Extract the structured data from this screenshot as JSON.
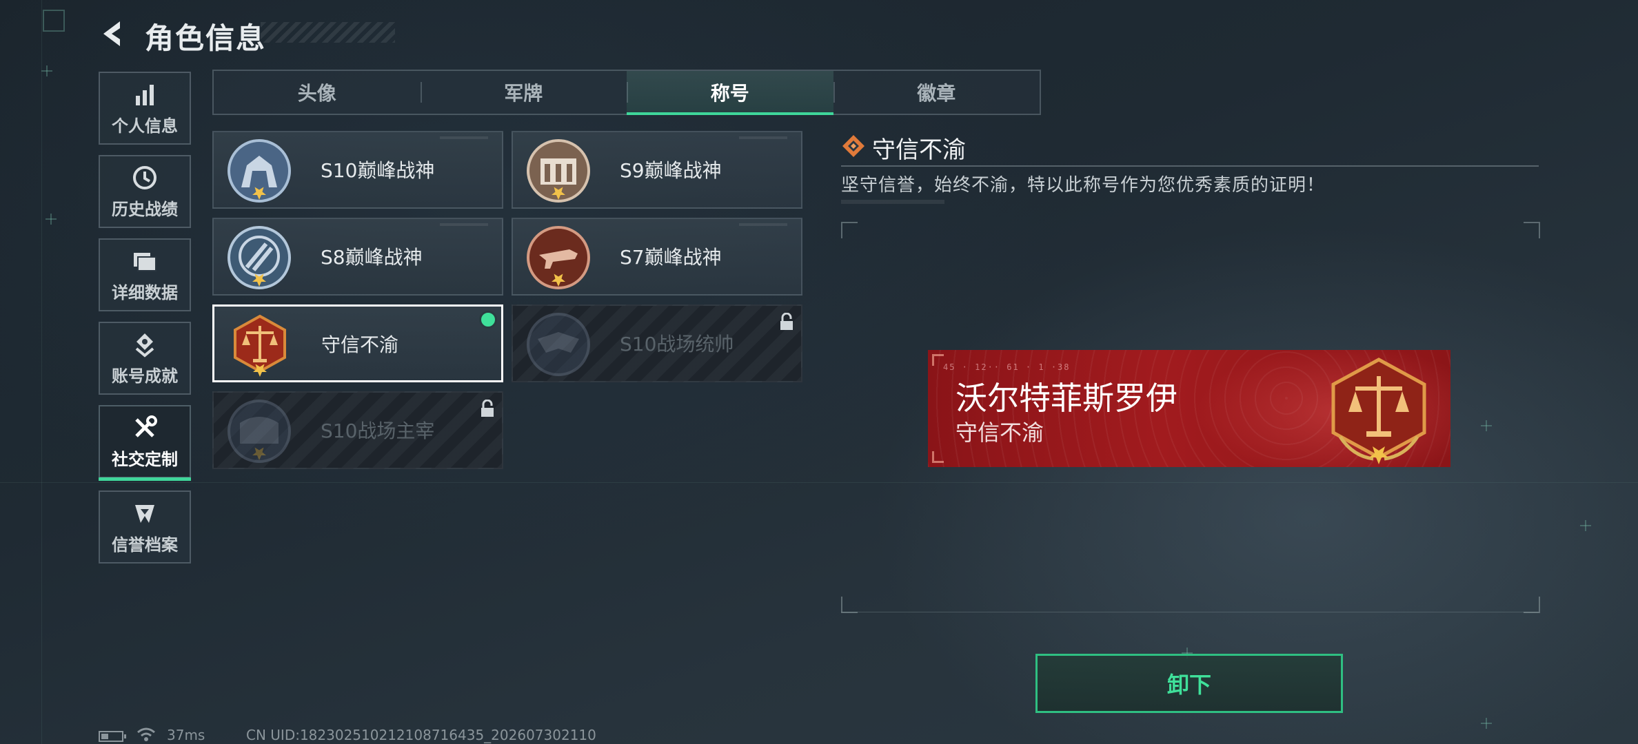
{
  "header": {
    "title": "角色信息"
  },
  "sidebar": {
    "items": [
      {
        "label": "个人信息",
        "icon": "bar-chart-icon"
      },
      {
        "label": "历史战绩",
        "icon": "clock-history-icon"
      },
      {
        "label": "详细数据",
        "icon": "folders-icon"
      },
      {
        "label": "账号成就",
        "icon": "achievement-icon"
      },
      {
        "label": "社交定制",
        "icon": "tools-icon",
        "active": true
      },
      {
        "label": "信誉档案",
        "icon": "emblem-icon"
      }
    ]
  },
  "tabs": [
    {
      "label": "头像"
    },
    {
      "label": "军牌"
    },
    {
      "label": "称号",
      "active": true
    },
    {
      "label": "徽章"
    }
  ],
  "titles": [
    {
      "name": "S10巅峰战神",
      "locked": false
    },
    {
      "name": "S9巅峰战神",
      "locked": false
    },
    {
      "name": "S8巅峰战神",
      "locked": false
    },
    {
      "name": "S7巅峰战神",
      "locked": false
    },
    {
      "name": "守信不渝",
      "locked": false,
      "selected": true,
      "equipped": true
    },
    {
      "name": "S10战场统帅",
      "locked": true
    },
    {
      "name": "S10战场主宰",
      "locked": true
    }
  ],
  "detail": {
    "title": "守信不渝",
    "description": "坚守信誉，始终不渝，特以此称号作为您优秀素质的证明！"
  },
  "preview": {
    "player_name": "沃尔特菲斯罗伊",
    "title": "守信不渝",
    "micro_text": "45 · 12·· 61 · 1 ·38"
  },
  "actions": {
    "unequip_label": "卸下"
  },
  "status": {
    "ping": "37ms",
    "uid": "CN UID:18230251021210871643​5_202607302110",
    "battery_fraction": 0.35
  },
  "colors": {
    "accent_green": "#3fd69a",
    "banner_red": "#a11b1e",
    "background": "#1f2a33"
  }
}
